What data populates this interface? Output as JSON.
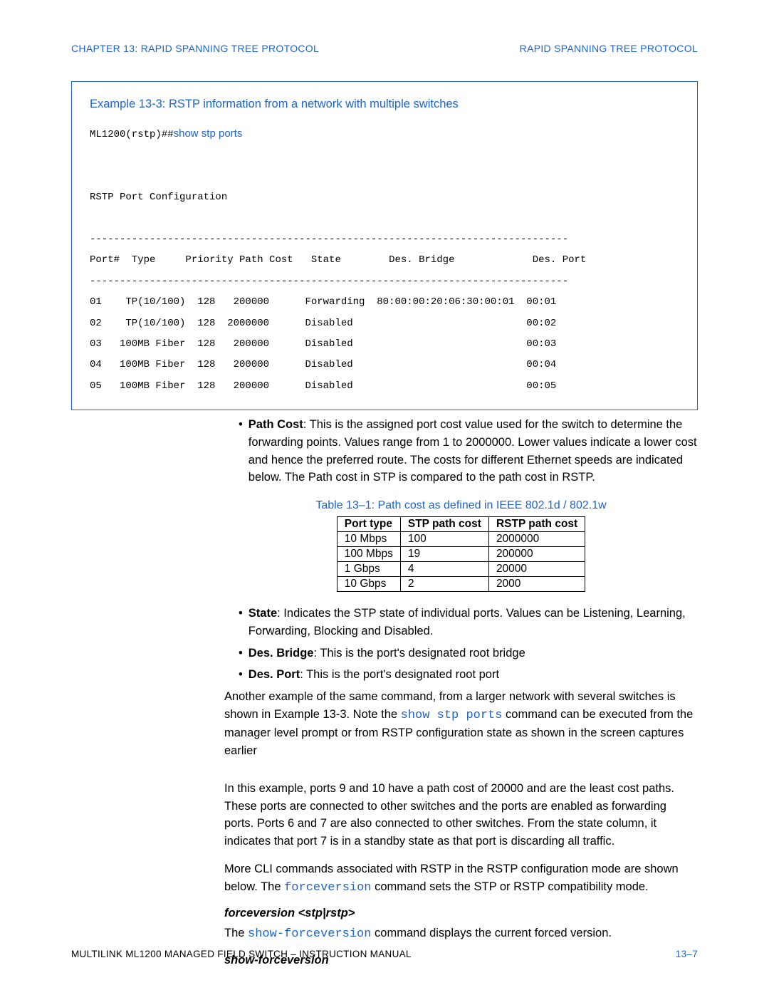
{
  "header": {
    "left": "CHAPTER 13:  RAPID SPANNING TREE PROTOCOL",
    "right": "RAPID SPANNING TREE PROTOCOL"
  },
  "example": {
    "title": "Example 13-3: RSTP information from a network with multiple switches",
    "prompt": "ML1200(rstp)##",
    "command": "show stp ports",
    "heading": "RSTP Port Configuration",
    "divider": "--------------------------------------------------------------------------------",
    "col_header": "Port#  Type     Priority Path Cost   State        Des. Bridge             Des. Port",
    "rows": [
      "01    TP(10/100)  128   200000      Forwarding  80:00:00:20:06:30:00:01  00:01",
      "02    TP(10/100)  128  2000000      Disabled                             00:02",
      "03   100MB Fiber  128   200000      Disabled                             00:03",
      "04   100MB Fiber  128   200000      Disabled                             00:04",
      "05   100MB Fiber  128   200000      Disabled                             00:05"
    ]
  },
  "bullets_a": {
    "path_cost_label": "Path Cost",
    "path_cost_text": ": This is the assigned port cost value used for the switch to determine the forwarding points. Values range from 1 to 2000000. Lower values indicate a lower cost and hence the preferred route. The costs for different Ethernet speeds are indicated below. The Path cost in STP is compared to the path cost in RSTP."
  },
  "table": {
    "title": "Table 13–1: Path cost as defined in IEEE 802.1d / 802.1w",
    "headers": [
      "Port type",
      "STP path cost",
      "RSTP path cost"
    ],
    "rows": [
      [
        "10 Mbps",
        "100",
        "2000000"
      ],
      [
        "100 Mbps",
        "19",
        "200000"
      ],
      [
        "1 Gbps",
        "4",
        "20000"
      ],
      [
        "10 Gbps",
        "2",
        "2000"
      ]
    ]
  },
  "bullets_b": {
    "state_label": "State",
    "state_text": ": Indicates the STP state of individual ports. Values can be Listening, Learning, Forwarding, Blocking and Disabled.",
    "desbridge_label": "Des. Bridge",
    "desbridge_text": ": This is the port's designated root bridge",
    "desport_label": "Des. Port",
    "desport_text": ": This is the port's designated root port"
  },
  "paras": {
    "p1a": "Another example of the same command, from a larger network with several switches is shown in Example 13-3. Note the ",
    "p1cmd": "show stp ports",
    "p1b": " command can be executed from the manager level prompt or from RSTP configuration state as shown in the screen captures earlier",
    "p2": "In this example, ports 9 and 10 have a path cost of 20000 and are the least cost paths. These ports are connected to other switches and the ports are enabled as forwarding ports. Ports 6 and 7 are also connected to other switches. From the state column, it indicates that port 7 is in a standby state as that port is discarding all traffic.",
    "p3a": "More CLI commands associated with RSTP in the RSTP configuration mode are shown below. The ",
    "p3cmd": "forceversion",
    "p3b": " command sets the STP or RSTP compatibility mode.",
    "syntax1": "forceversion <stp|rstp>",
    "p4a": "The ",
    "p4cmd": "show-forceversion",
    "p4b": " command displays the current forced version.",
    "syntax2": "show-forceversion"
  },
  "footer": {
    "left": "MULTILINK ML1200 MANAGED FIELD SWITCH – INSTRUCTION MANUAL",
    "right": "13–7"
  },
  "chart_data": {
    "type": "table",
    "title": "Path cost as defined in IEEE 802.1d / 802.1w",
    "columns": [
      "Port type",
      "STP path cost",
      "RSTP path cost"
    ],
    "rows": [
      {
        "port_type": "10 Mbps",
        "stp_path_cost": 100,
        "rstp_path_cost": 2000000
      },
      {
        "port_type": "100 Mbps",
        "stp_path_cost": 19,
        "rstp_path_cost": 200000
      },
      {
        "port_type": "1 Gbps",
        "stp_path_cost": 4,
        "rstp_path_cost": 20000
      },
      {
        "port_type": "10 Gbps",
        "stp_path_cost": 2,
        "rstp_path_cost": 2000
      }
    ]
  }
}
